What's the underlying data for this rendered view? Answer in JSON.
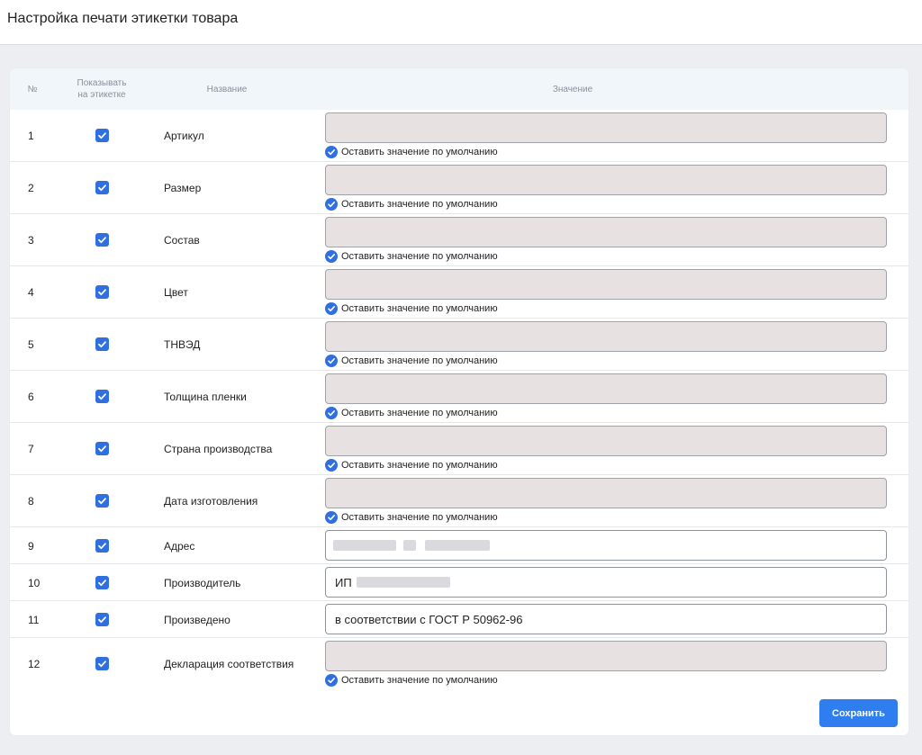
{
  "page": {
    "title": "Настройка печати этикетки товара"
  },
  "colors": {
    "accent": "#2f6fe0",
    "disabled_input_bg": "#e7e1e1",
    "header_bg": "#f1f6fb"
  },
  "table": {
    "headers": {
      "num": "№",
      "show_line1": "Показывать",
      "show_line2": "на этикетке",
      "name": "Название",
      "value": "Значение"
    },
    "default_label": "Оставить значение по умолчанию",
    "rows": [
      {
        "num": "1",
        "name": "Артикул",
        "show": true,
        "use_default": true,
        "value": ""
      },
      {
        "num": "2",
        "name": "Размер",
        "show": true,
        "use_default": true,
        "value": ""
      },
      {
        "num": "3",
        "name": "Состав",
        "show": true,
        "use_default": true,
        "value": ""
      },
      {
        "num": "4",
        "name": "Цвет",
        "show": true,
        "use_default": true,
        "value": ""
      },
      {
        "num": "5",
        "name": "ТНВЭД",
        "show": true,
        "use_default": true,
        "value": ""
      },
      {
        "num": "6",
        "name": "Толщина пленки",
        "show": true,
        "use_default": true,
        "value": ""
      },
      {
        "num": "7",
        "name": "Страна производства",
        "show": true,
        "use_default": true,
        "value": ""
      },
      {
        "num": "8",
        "name": "Дата изготовления",
        "show": true,
        "use_default": true,
        "value": ""
      },
      {
        "num": "9",
        "name": "Адрес",
        "show": true,
        "use_default": false,
        "value": ""
      },
      {
        "num": "10",
        "name": "Производитель",
        "show": true,
        "use_default": false,
        "value": "ИП"
      },
      {
        "num": "11",
        "name": "Произведено",
        "show": true,
        "use_default": false,
        "value": "в соответствии с ГОСТ Р 50962-96"
      },
      {
        "num": "12",
        "name": "Декларация соответствия",
        "show": true,
        "use_default": true,
        "value": ""
      }
    ]
  },
  "actions": {
    "save_label": "Сохранить"
  }
}
